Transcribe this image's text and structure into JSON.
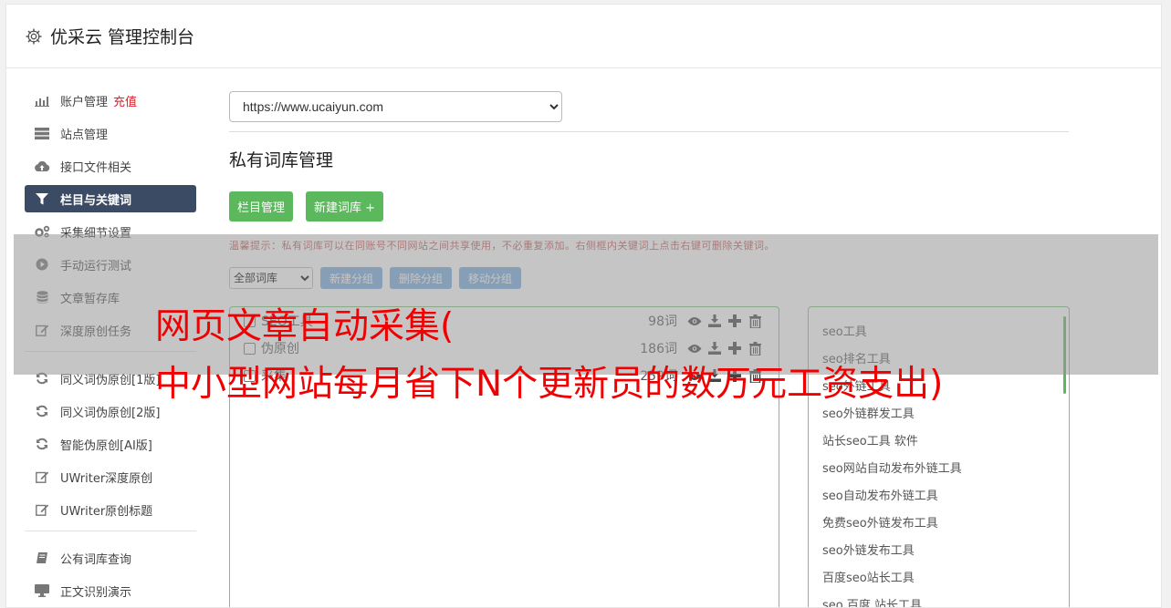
{
  "header": {
    "title": "优采云 管理控制台",
    "icon": "gear-icon"
  },
  "sidebar": {
    "recharge_label": "充值",
    "items": [
      {
        "label": "账户管理",
        "icon": "bar-chart-icon"
      },
      {
        "label": "站点管理",
        "icon": "server-icon"
      },
      {
        "label": "接口文件相关",
        "icon": "cloud-upload-icon"
      },
      {
        "label": "栏目与关键词",
        "icon": "filter-icon",
        "active": true
      },
      {
        "label": "采集细节设置",
        "icon": "gears-icon"
      },
      {
        "label": "手动运行测试",
        "icon": "play-icon"
      },
      {
        "label": "文章暂存库",
        "icon": "database-icon"
      },
      {
        "label": "深度原创任务",
        "icon": "edit-icon"
      },
      {
        "label": "同义词伪原创[1版]",
        "icon": "refresh-icon"
      },
      {
        "label": "同义词伪原创[2版]",
        "icon": "refresh-icon"
      },
      {
        "label": "智能伪原创[AI版]",
        "icon": "refresh-icon"
      },
      {
        "label": "UWriter深度原创",
        "icon": "edit-icon"
      },
      {
        "label": "UWriter原创标题",
        "icon": "edit-icon"
      },
      {
        "label": "公有词库查询",
        "icon": "book-icon"
      },
      {
        "label": "正文识别演示",
        "icon": "desktop-icon"
      }
    ]
  },
  "main": {
    "site_select_value": "https://www.ucaiyun.com",
    "page_title": "私有词库管理",
    "btn_column_manage": "栏目管理",
    "btn_new_library": "新建词库 +",
    "hint": "温馨提示：私有词库可以在同账号不同网站之间共享使用，不必重复添加。右侧框内关键词上点击右键可删除关键词。",
    "group_select_value": "全部词库",
    "btn_new_group": "新建分组",
    "btn_delete_group": "删除分组",
    "btn_move_group": "移动分组",
    "libraries": [
      {
        "name": "SEO工具",
        "count": "98词"
      },
      {
        "name": "伪原创",
        "count": "186词"
      },
      {
        "name": "采集",
        "count": "259词"
      }
    ],
    "keywords": [
      "seo工具",
      "seo排名工具",
      "seo外链工具",
      "seo外链群发工具",
      "站长seo工具 软件",
      "seo网站自动发布外链工具",
      "seo自动发布外链工具",
      "免费seo外链发布工具",
      "seo外链发布工具",
      "百度seo站长工具",
      "seo 百度 站长工具"
    ]
  },
  "overlay": {
    "line1": "网页文章自动采集(",
    "line2": "中小型网站每月省下N个更新员的数万元工资支出)"
  },
  "colors": {
    "accent_green": "#5cb85c",
    "active_nav": "#3c4b64",
    "overlay_text": "#f00000",
    "btn_blue": "#76a9e0"
  }
}
